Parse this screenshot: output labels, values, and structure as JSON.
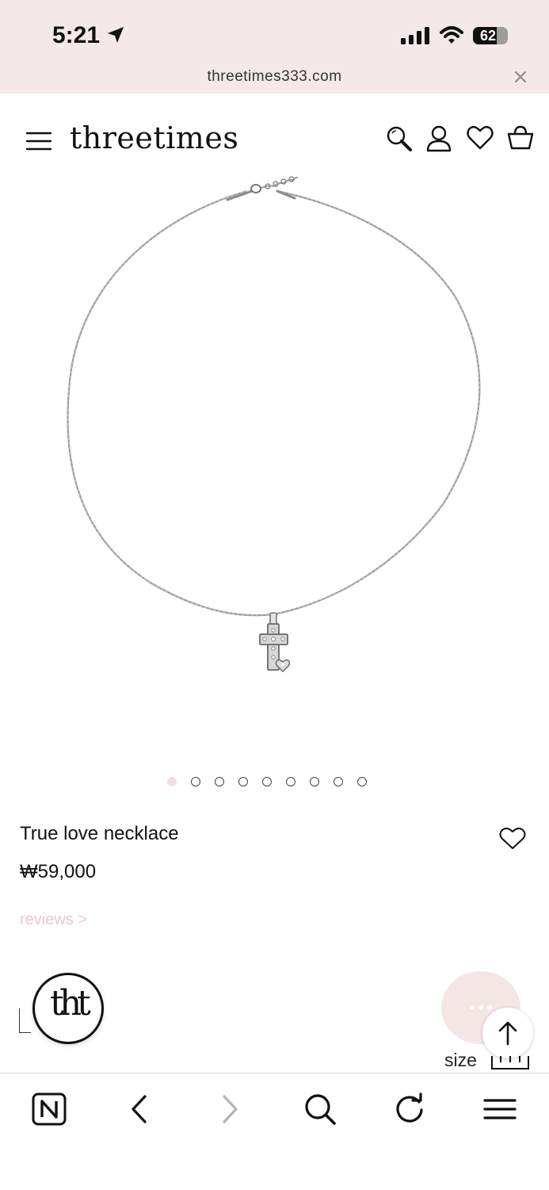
{
  "status_bar": {
    "time": "5:21",
    "battery": "62",
    "battery_level": 0.62
  },
  "browser": {
    "url": "threetimes333.com"
  },
  "header": {
    "logo": "threetimes"
  },
  "product": {
    "name": "True love necklace",
    "price": "₩59,000",
    "reviews_link": "reviews >",
    "image_count": 9,
    "active_image": 1
  },
  "floating": {
    "badge_text": "tht",
    "size_label": "size"
  },
  "colors": {
    "status_bg": "#f5e8e8",
    "accent_pink": "#f3dfe2",
    "reviews_pink": "#e9c9cc",
    "text": "#111111"
  },
  "icons": {
    "header": [
      "menu-icon",
      "search-icon",
      "user-icon",
      "heart-icon",
      "cart-icon"
    ],
    "bottom_bar": [
      "naver-icon",
      "back-icon",
      "forward-icon",
      "search-icon",
      "refresh-icon",
      "menu-icon"
    ]
  }
}
